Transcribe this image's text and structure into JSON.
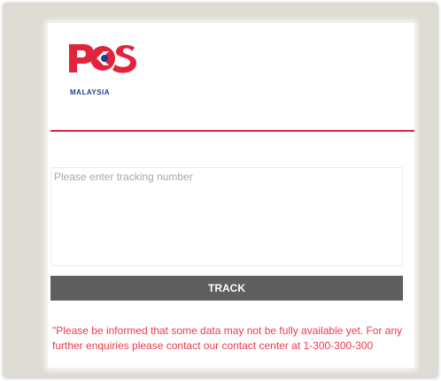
{
  "brand": {
    "logo_text": "POS",
    "logo_subtext": "MALAYSIA",
    "logo_red": "#e2233c",
    "logo_blue": "#1d3f8f"
  },
  "tracking": {
    "placeholder": "Please enter tracking number",
    "value": ""
  },
  "track_button": {
    "label": "TRACK",
    "color": "#5f5f5f"
  },
  "notice": {
    "text": "\"Please be informed that some data may not be fully available yet. For any further enquiries please contact our contact center at 1-300-300-300",
    "color": "#f0384a"
  }
}
